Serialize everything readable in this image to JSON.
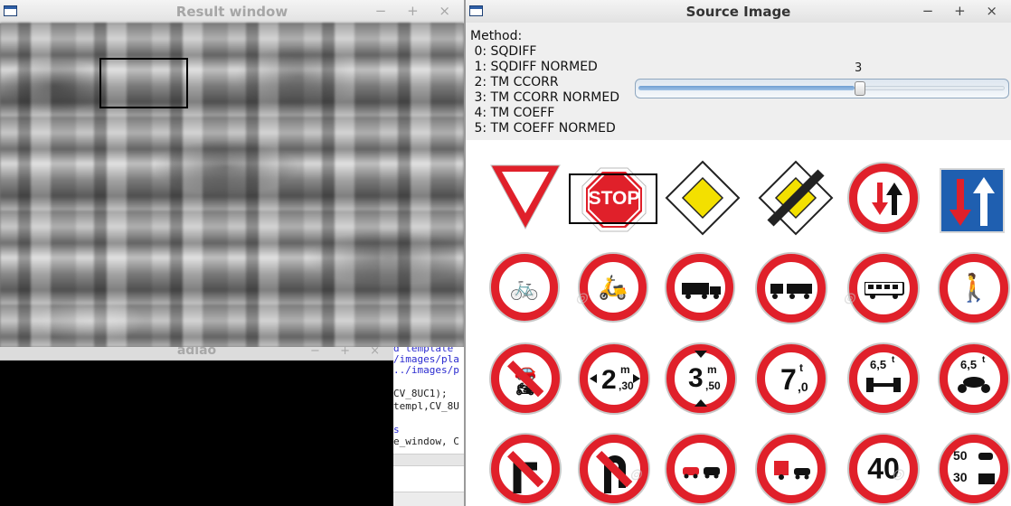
{
  "result_window": {
    "title": "Result window",
    "controls": "− + ×"
  },
  "terminal_window": {
    "title": "adiao",
    "controls": "− + ×"
  },
  "editor": {
    "lines": [
      "d template",
      "/images/pla",
      "../images/p",
      "CV_8UC1);",
      "templ,CV_8U",
      "s",
      "e_window, C"
    ]
  },
  "source_window": {
    "title": "Source Image",
    "controls": "− + ×",
    "methods": [
      "Method:",
      " 0: SQDIFF",
      " 1: SQDIFF NORMED",
      " 2: TM CCORR",
      " 3: TM CCORR NORMED",
      " 4: TM COEFF",
      " 5: TM COEFF NORMED"
    ],
    "trackbar": {
      "value": "3",
      "fraction": 0.6
    }
  },
  "signs": {
    "row1": {
      "stop": "STOP"
    },
    "row3": {
      "w_num": "2",
      "w_unit": "m",
      "w_dec": ",30",
      "h_num": "3",
      "h_unit": "m",
      "h_dec": ",50",
      "wt_num": "7",
      "wt_unit": "t",
      "wt_dec": ",0",
      "axle1": "6,5",
      "axle1_unit": "t",
      "axle2": "6,5",
      "axle2_unit": "t"
    },
    "row4": {
      "speed": "40",
      "top_limit": "50",
      "bottom_limit": "30"
    }
  },
  "colors": {
    "sign_red": "#e0202a",
    "sign_blue": "#1f5fb0",
    "diamond_yellow": "#f3e000"
  }
}
